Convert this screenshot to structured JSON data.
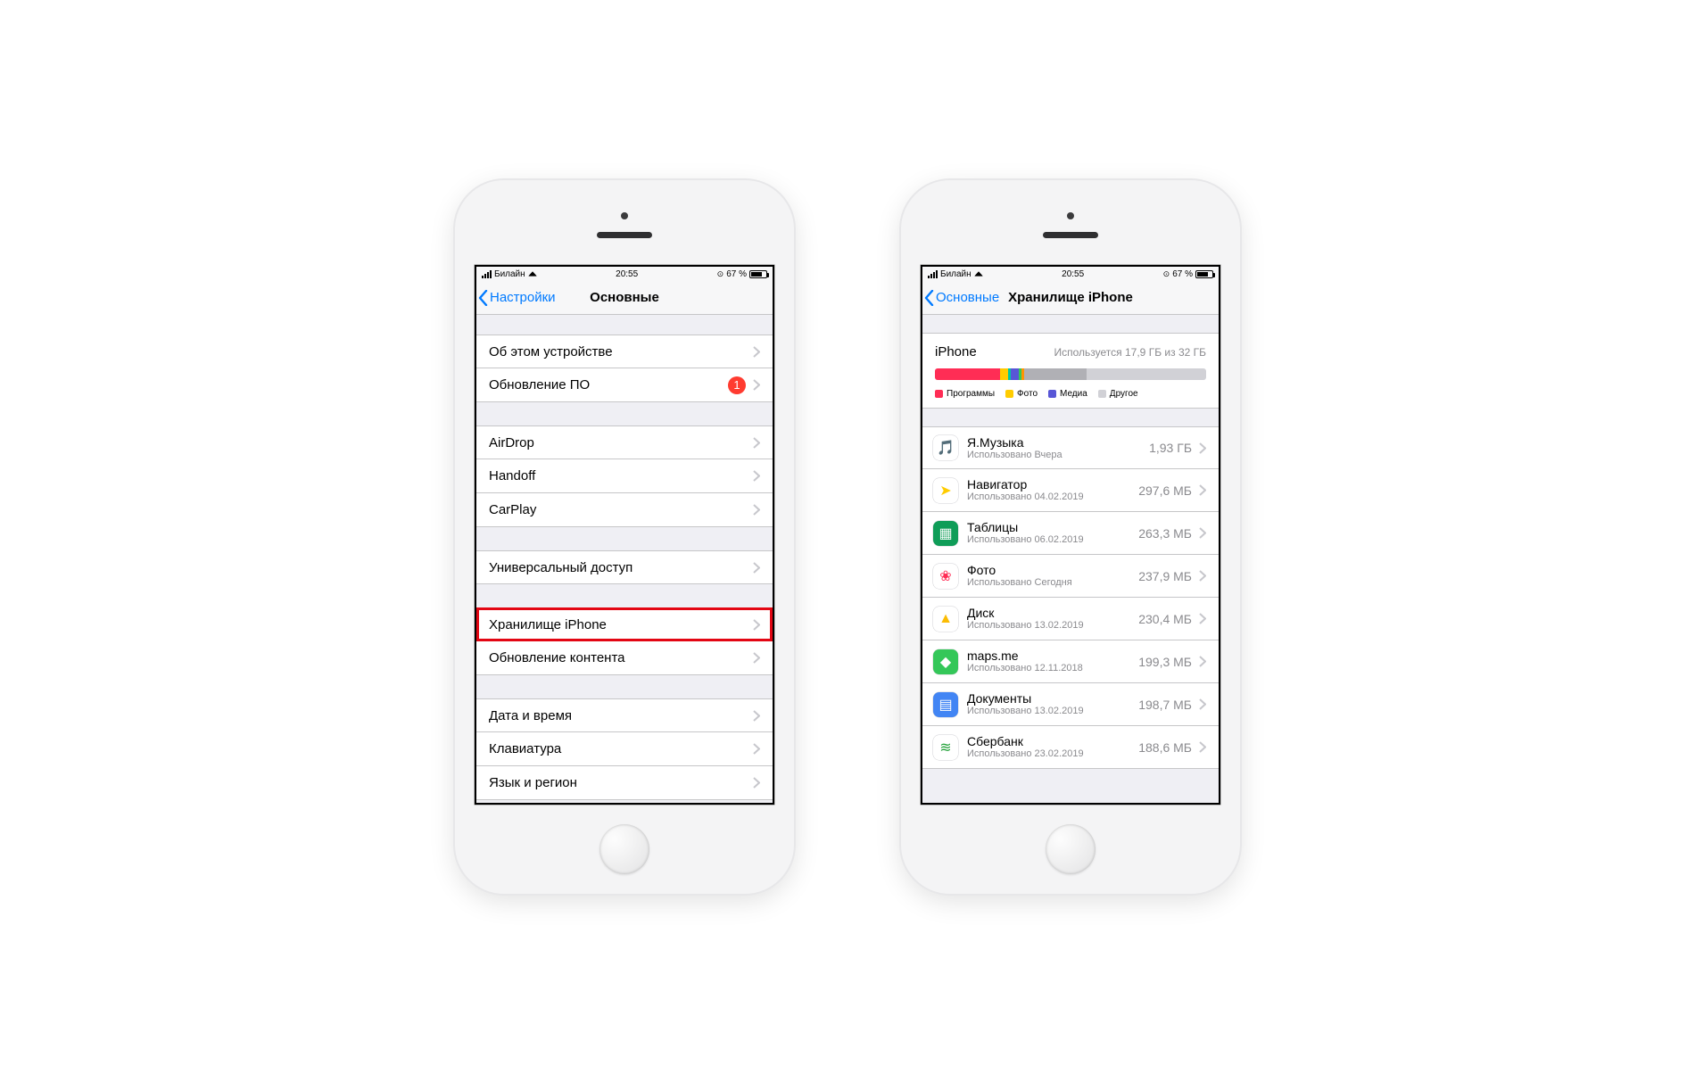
{
  "status": {
    "carrier": "Билайн",
    "time": "20:55",
    "battery_pct": "67 %"
  },
  "left": {
    "back_label": "Настройки",
    "title": "Основные",
    "groups": [
      [
        {
          "label": "Об этом устройстве",
          "badge": null
        },
        {
          "label": "Обновление ПО",
          "badge": "1"
        }
      ],
      [
        {
          "label": "AirDrop",
          "badge": null
        },
        {
          "label": "Handoff",
          "badge": null
        },
        {
          "label": "CarPlay",
          "badge": null
        }
      ],
      [
        {
          "label": "Универсальный доступ",
          "badge": null
        }
      ],
      [
        {
          "label": "Хранилище iPhone",
          "badge": null,
          "highlight": true
        },
        {
          "label": "Обновление контента",
          "badge": null
        }
      ],
      [
        {
          "label": "Дата и время",
          "badge": null
        },
        {
          "label": "Клавиатура",
          "badge": null
        },
        {
          "label": "Язык и регион",
          "badge": null
        }
      ]
    ]
  },
  "right": {
    "back_label": "Основные",
    "title": "Хранилище iPhone",
    "device": "iPhone",
    "used_text": "Используется 17,9 ГБ из 32 ГБ",
    "segments": [
      {
        "color": "#ff2d55",
        "pct": 24
      },
      {
        "color": "#ffcc00",
        "pct": 3
      },
      {
        "color": "#00c7a3",
        "pct": 1
      },
      {
        "color": "#5856d6",
        "pct": 3
      },
      {
        "color": "#34c759",
        "pct": 1
      },
      {
        "color": "#ff9500",
        "pct": 1
      },
      {
        "color": "#b0b0b5",
        "pct": 23
      }
    ],
    "legend": [
      {
        "color": "#ff2d55",
        "label": "Программы"
      },
      {
        "color": "#ffcc00",
        "label": "Фото"
      },
      {
        "color": "#5856d6",
        "label": "Медиа"
      },
      {
        "color": "#d1d1d6",
        "label": "Другое"
      }
    ],
    "apps": [
      {
        "name": "Я.Музыка",
        "sub": "Использовано Вчера",
        "size": "1,93 ГБ",
        "bg": "#ffffff",
        "glyph": "🎵",
        "gc": "#ffcc00"
      },
      {
        "name": "Навигатор",
        "sub": "Использовано 04.02.2019",
        "size": "297,6 МБ",
        "bg": "#ffffff",
        "glyph": "➤",
        "gc": "#ffcc00"
      },
      {
        "name": "Таблицы",
        "sub": "Использовано 06.02.2019",
        "size": "263,3 МБ",
        "bg": "#0f9d58",
        "glyph": "▦",
        "gc": "#ffffff"
      },
      {
        "name": "Фото",
        "sub": "Использовано Сегодня",
        "size": "237,9 МБ",
        "bg": "#ffffff",
        "glyph": "❀",
        "gc": "#ff2d55"
      },
      {
        "name": "Диск",
        "sub": "Использовано 13.02.2019",
        "size": "230,4 МБ",
        "bg": "#ffffff",
        "glyph": "▲",
        "gc": "#fbbc04"
      },
      {
        "name": "maps.me",
        "sub": "Использовано 12.11.2018",
        "size": "199,3 МБ",
        "bg": "#34c759",
        "glyph": "◆",
        "gc": "#ffffff"
      },
      {
        "name": "Документы",
        "sub": "Использовано 13.02.2019",
        "size": "198,7 МБ",
        "bg": "#4285f4",
        "glyph": "▤",
        "gc": "#ffffff"
      },
      {
        "name": "Сбербанк",
        "sub": "Использовано 23.02.2019",
        "size": "188,6 МБ",
        "bg": "#ffffff",
        "glyph": "≋",
        "gc": "#21a038"
      }
    ]
  }
}
